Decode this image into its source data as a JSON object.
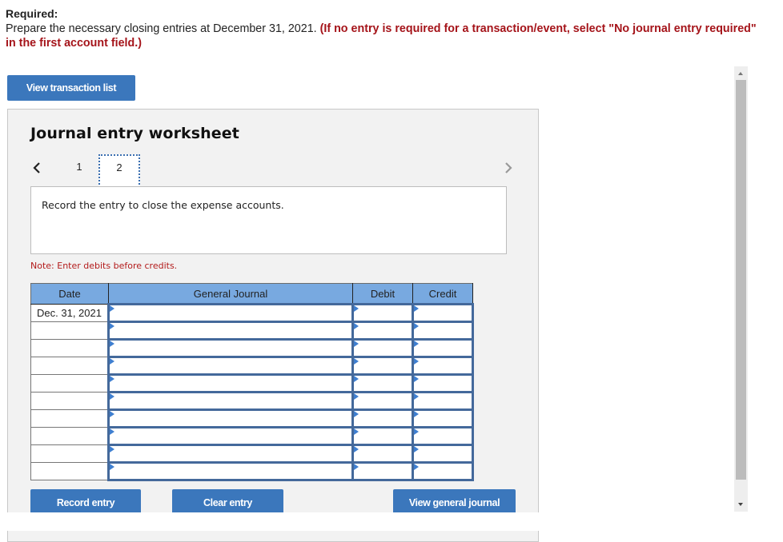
{
  "required": {
    "heading": "Required:",
    "instruction": "Prepare the necessary closing entries at December 31, 2021.",
    "emphasis": "(If no entry is required for a transaction/event, select \"No journal entry required\" in the first account field.)"
  },
  "buttons": {
    "view_transaction_list": "View transaction list",
    "record_entry": "Record entry",
    "clear_entry": "Clear entry",
    "view_general_journal": "View general journal"
  },
  "worksheet": {
    "title": "Journal entry worksheet",
    "tabs": [
      {
        "label": "1",
        "active": false
      },
      {
        "label": "2",
        "active": true
      }
    ],
    "prev_icon": "chevron-left-icon",
    "next_icon": "chevron-right-icon",
    "description": "Record the entry to close the expense accounts.",
    "note": "Note: Enter debits before credits."
  },
  "table": {
    "headers": [
      "Date",
      "General Journal",
      "Debit",
      "Credit"
    ],
    "rows": [
      {
        "date": "Dec. 31, 2021",
        "account": "",
        "debit": "",
        "credit": ""
      },
      {
        "date": "",
        "account": "",
        "debit": "",
        "credit": ""
      },
      {
        "date": "",
        "account": "",
        "debit": "",
        "credit": ""
      },
      {
        "date": "",
        "account": "",
        "debit": "",
        "credit": ""
      },
      {
        "date": "",
        "account": "",
        "debit": "",
        "credit": ""
      },
      {
        "date": "",
        "account": "",
        "debit": "",
        "credit": ""
      },
      {
        "date": "",
        "account": "",
        "debit": "",
        "credit": ""
      },
      {
        "date": "",
        "account": "",
        "debit": "",
        "credit": ""
      },
      {
        "date": "",
        "account": "",
        "debit": "",
        "credit": ""
      },
      {
        "date": "",
        "account": "",
        "debit": "",
        "credit": ""
      }
    ]
  },
  "colors": {
    "button_blue": "#3b77bc",
    "header_blue": "#78a9e0",
    "cell_border": "#44699b",
    "emphasis_red": "#a5141a",
    "note_red": "#b31b1b",
    "panel_bg": "#f2f2f2"
  }
}
